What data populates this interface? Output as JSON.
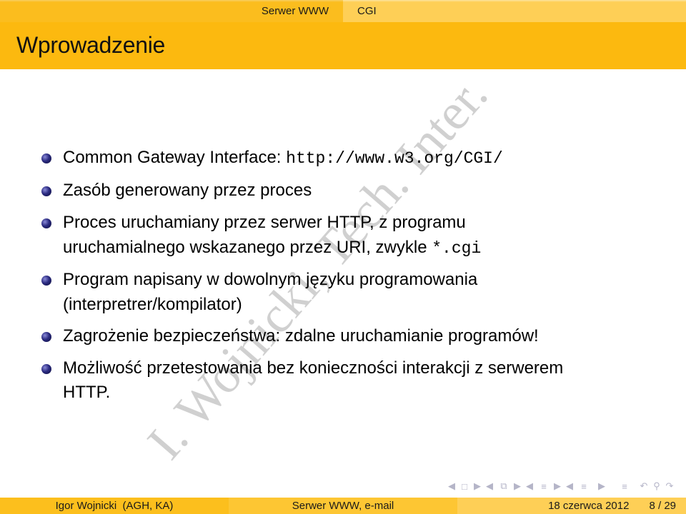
{
  "header": {
    "section": "Serwer WWW",
    "subsection": "CGI",
    "frame_title": "Wprowadzenie"
  },
  "items": [
    {
      "lines": [
        "Common Gateway Interface: "
      ],
      "code": "http://www.w3.org/CGI/"
    },
    {
      "lines": [
        "Zasób generowany przez proces"
      ]
    },
    {
      "lines": [
        "Proces uruchamiany przez serwer HTTP, z programu",
        "uruchamialnego wskazanego przez URI, zwykle "
      ],
      "code": "*.cgi"
    },
    {
      "lines": [
        "Program napisany w dowolnym języku programowania",
        "(interpretrer/kompilator)"
      ]
    },
    {
      "lines": [
        "Zagrożenie bezpieczeństwa: zdalne uruchamianie programów!"
      ]
    },
    {
      "lines": [
        "Możliwość przetestowania bez konieczności interakcji z serwerem",
        "HTTP."
      ]
    }
  ],
  "watermark": "I. Wojnicki, Tech. Inter.",
  "navigation": {
    "icons": [
      "prev-arrow",
      "frame",
      "next-arrow",
      "prev-arrow",
      "subsection",
      "next-arrow",
      "prev-arrow",
      "section",
      "next-arrow",
      "prev-arrow",
      "section-list",
      "next-arrow",
      "outline",
      "back",
      "search",
      "forward"
    ]
  },
  "footer": {
    "author": "Igor Wojnicki  (AGH, KA)",
    "short_title": "Serwer WWW, e-mail",
    "date": "18 czerwca 2012",
    "page": "8 / 29"
  },
  "colors": {
    "header_dark": "#fbbd1e",
    "header_light": "#fecf56",
    "title_bar": "#fcb90f",
    "bullet": "#2a2a80"
  }
}
